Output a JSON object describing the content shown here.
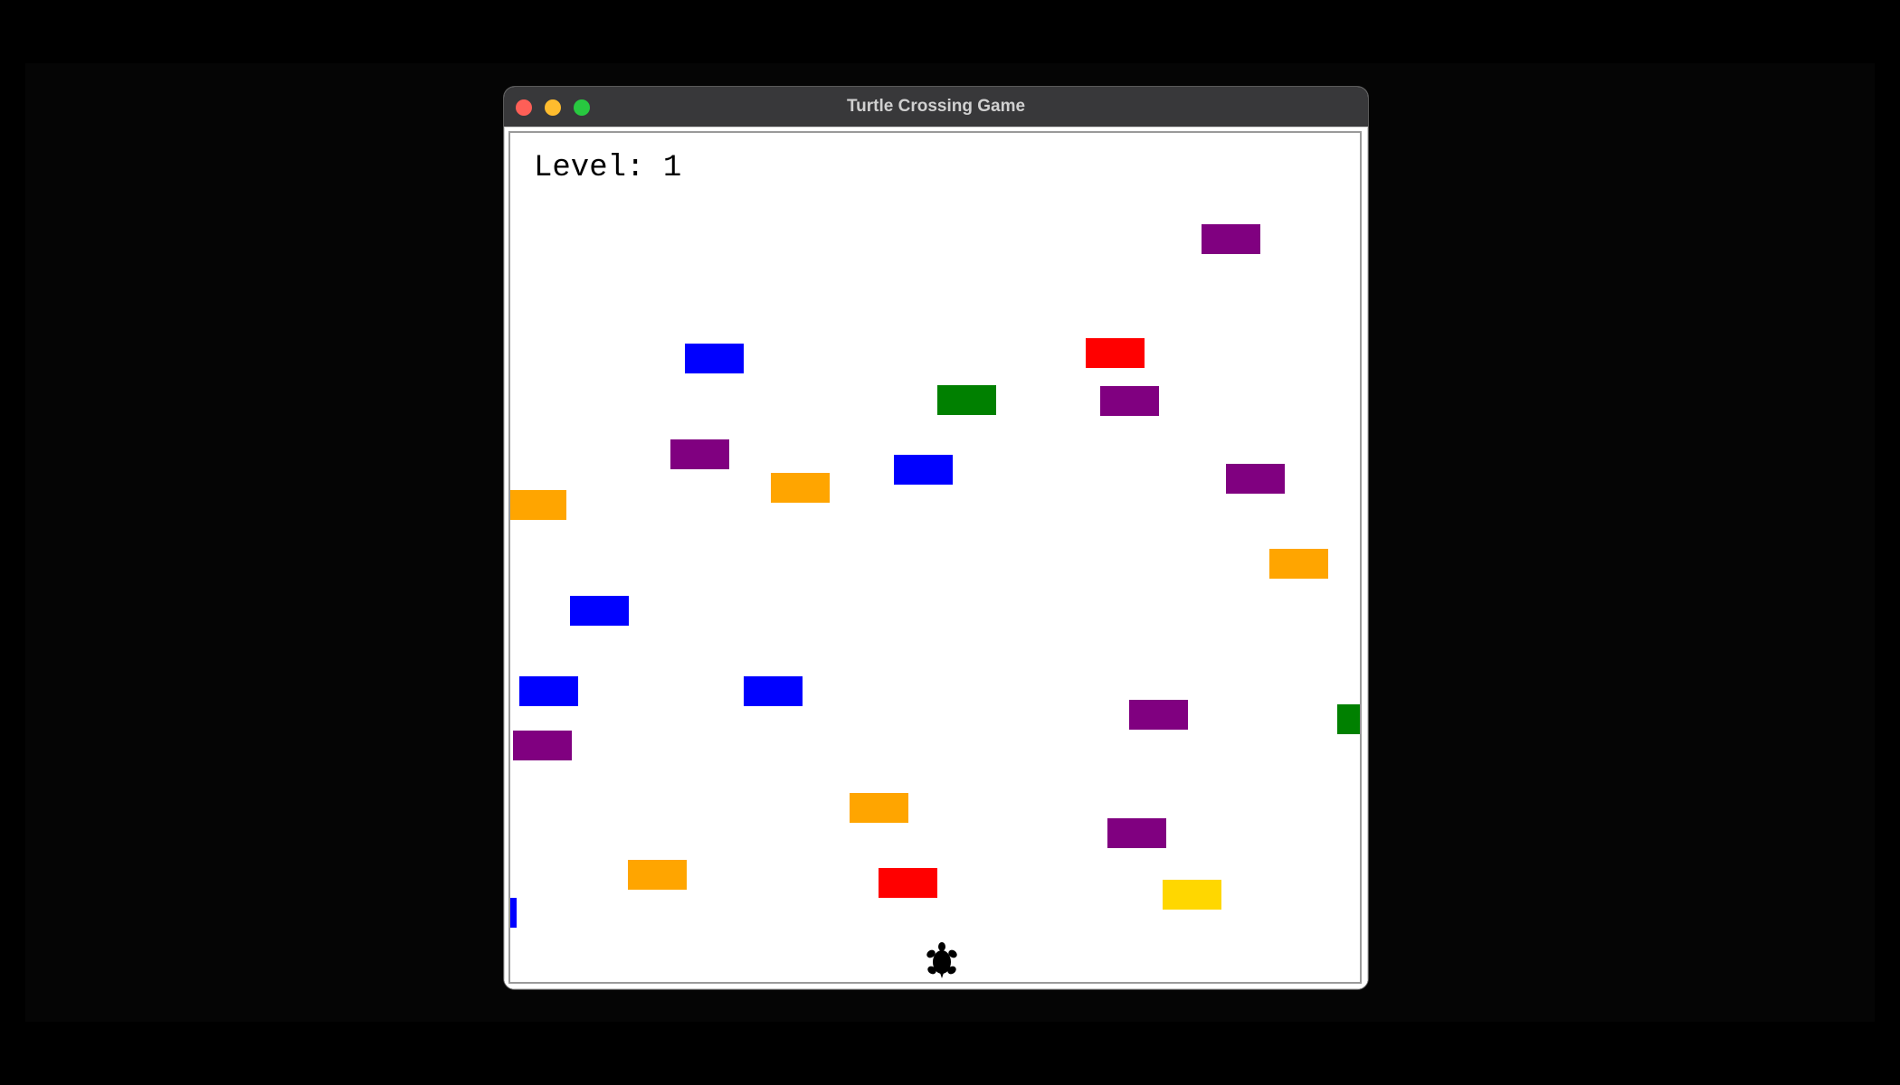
{
  "window": {
    "title": "Turtle Crossing Game"
  },
  "scoreboard": {
    "level_text": "Level: 1",
    "level": 1
  },
  "colors": {
    "purple": "#800080",
    "blue": "#0000ff",
    "red": "#ff0000",
    "green": "#008000",
    "orange": "#ffa500",
    "yellow": "#ffd700",
    "turtle": "#000000"
  },
  "cars": [
    {
      "color": "purple"
    },
    {
      "color": "blue"
    },
    {
      "color": "red"
    },
    {
      "color": "green"
    },
    {
      "color": "purple"
    },
    {
      "color": "purple"
    },
    {
      "color": "blue"
    },
    {
      "color": "orange"
    },
    {
      "color": "purple"
    },
    {
      "color": "orange"
    },
    {
      "color": "orange"
    },
    {
      "color": "blue"
    },
    {
      "color": "blue"
    },
    {
      "color": "blue"
    },
    {
      "color": "purple"
    },
    {
      "color": "green"
    },
    {
      "color": "purple"
    },
    {
      "color": "orange"
    },
    {
      "color": "purple"
    },
    {
      "color": "orange"
    },
    {
      "color": "red"
    },
    {
      "color": "yellow"
    },
    {
      "color": "blue"
    }
  ],
  "player": {
    "icon": "turtle-icon"
  }
}
